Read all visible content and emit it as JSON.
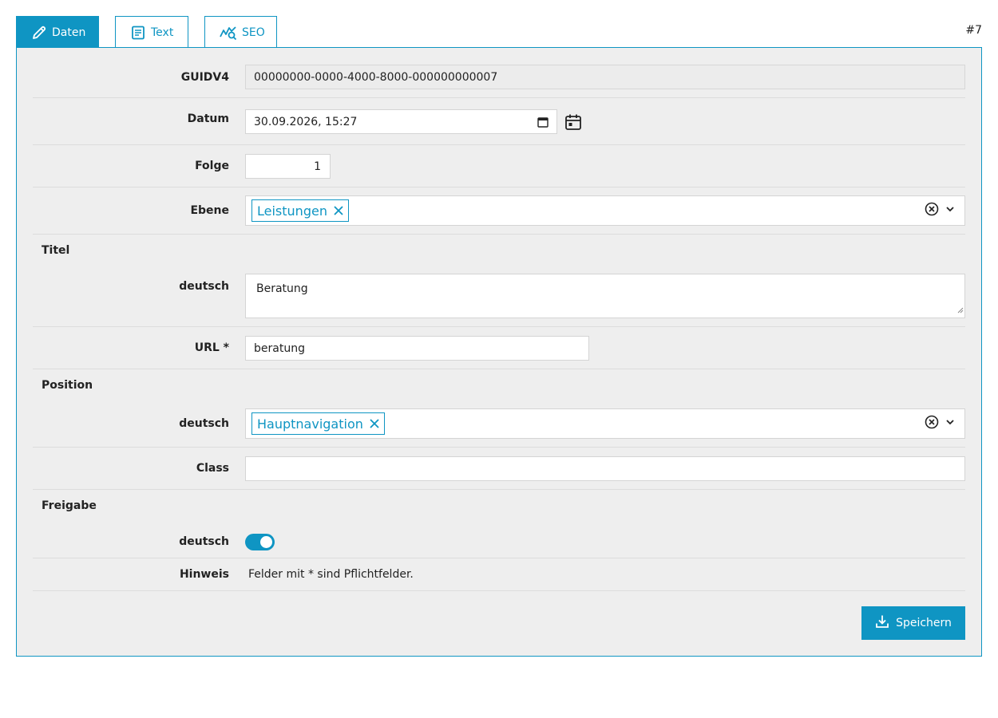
{
  "tabs": [
    {
      "label": "Daten",
      "icon": "pencil-icon",
      "active": true
    },
    {
      "label": "Text",
      "icon": "document-icon",
      "active": false
    },
    {
      "label": "SEO",
      "icon": "seo-chart-icon",
      "active": false
    }
  ],
  "record_id": "#7",
  "form": {
    "guid": {
      "label": "GUIDV4",
      "value": "00000000-0000-4000-8000-000000000007"
    },
    "datum": {
      "label": "Datum",
      "value": "30.09.2026, 15:27"
    },
    "folge": {
      "label": "Folge",
      "value": "1"
    },
    "ebene": {
      "label": "Ebene",
      "tag": "Leistungen"
    },
    "titel": {
      "section": "Titel",
      "label": "deutsch",
      "value": "Beratung"
    },
    "url": {
      "label": "URL *",
      "value": "beratung"
    },
    "position": {
      "section": "Position",
      "label": "deutsch",
      "tag": "Hauptnavigation"
    },
    "class": {
      "label": "Class",
      "value": ""
    },
    "freigabe": {
      "section": "Freigabe",
      "label": "deutsch",
      "enabled": true
    },
    "hinweis": {
      "label": "Hinweis",
      "text": "Felder mit * sind Pflichtfelder."
    }
  },
  "save_label": "Speichern",
  "colors": {
    "accent": "#0f95c3",
    "panel_bg": "#eeeeee"
  }
}
